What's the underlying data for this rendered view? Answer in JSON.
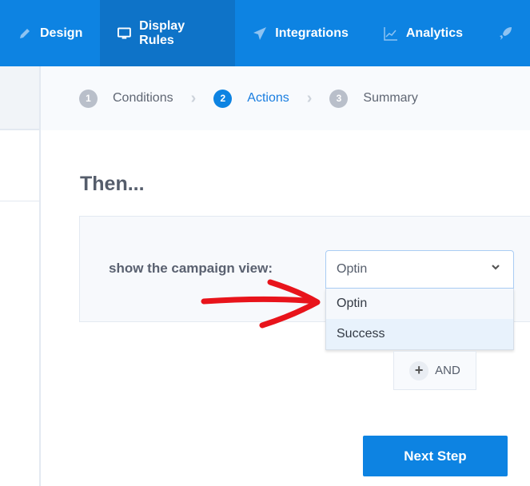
{
  "nav": {
    "items": [
      {
        "label": "Design",
        "icon": "pencil-icon"
      },
      {
        "label": "Display Rules",
        "icon": "monitor-icon",
        "active": true
      },
      {
        "label": "Integrations",
        "icon": "paper-plane-icon"
      },
      {
        "label": "Analytics",
        "icon": "chart-icon"
      },
      {
        "label": "",
        "icon": "rocket-icon"
      }
    ]
  },
  "steps": [
    {
      "num": "1",
      "label": "Conditions"
    },
    {
      "num": "2",
      "label": "Actions",
      "active": true
    },
    {
      "num": "3",
      "label": "Summary"
    }
  ],
  "main": {
    "title": "Then...",
    "rule_label": "show the campaign view:",
    "select_value": "Optin",
    "options": [
      "Optin",
      "Success"
    ],
    "and_label": "AND",
    "next_label": "Next Step"
  },
  "colors": {
    "accent": "#0d83e2",
    "annotation_arrow": "#e8141b"
  }
}
